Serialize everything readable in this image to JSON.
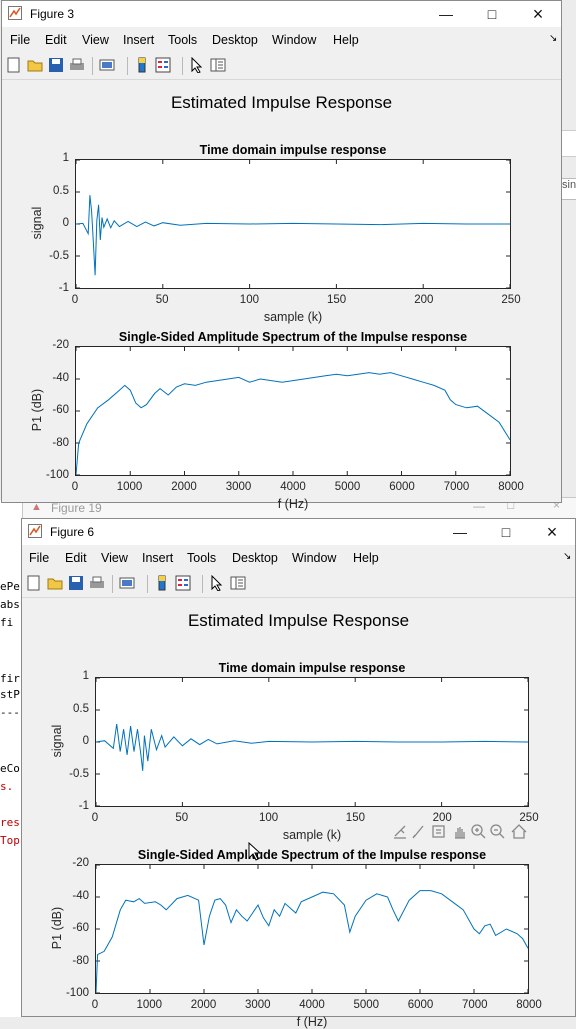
{
  "background": {
    "left_code_lines": [
      {
        "text": "ePe",
        "color": "#000000"
      },
      {
        "text": "abs",
        "color": "#000000"
      },
      {
        "text": " fi",
        "color": "#000000"
      },
      {
        "text": "fir",
        "color": "#000000"
      },
      {
        "text": "stP",
        "color": "#000000"
      },
      {
        "text": "---",
        "color": "#000000"
      },
      {
        "text": "eCo",
        "color": "#000000"
      },
      {
        "text": "s.",
        "color": "#c00000"
      },
      {
        "text": "res",
        "color": "#c00000"
      },
      {
        "text": "Top",
        "color": "#c00000"
      }
    ],
    "right_snippet": "sin",
    "figure19_title": "Figure 19"
  },
  "windows": [
    {
      "title": "Figure 3",
      "menus": [
        "File",
        "Edit",
        "View",
        "Insert",
        "Tools",
        "Desktop",
        "Window",
        "Help"
      ],
      "figure_title": "Estimated Impulse Response",
      "axes": [
        {
          "title": "Time domain impulse response",
          "xlabel": "sample (k)",
          "ylabel": "signal",
          "xticks": [
            "0",
            "50",
            "100",
            "150",
            "200",
            "250"
          ],
          "yticks": [
            "1",
            "0.5",
            "0",
            "-0.5",
            "-1"
          ]
        },
        {
          "title": "Single-Sided Amplitude Spectrum of the Impulse response",
          "xlabel": "f (Hz)",
          "ylabel": "P1 (dB)",
          "xticks": [
            "0",
            "1000",
            "2000",
            "3000",
            "4000",
            "5000",
            "6000",
            "7000",
            "8000"
          ],
          "yticks": [
            "-20",
            "-40",
            "-60",
            "-80",
            "-100"
          ]
        }
      ]
    },
    {
      "title": "Figure 6",
      "menus": [
        "File",
        "Edit",
        "View",
        "Insert",
        "Tools",
        "Desktop",
        "Window",
        "Help"
      ],
      "figure_title": "Estimated Impulse Response",
      "axes": [
        {
          "title": "Time domain impulse response",
          "xlabel": "sample (k)",
          "ylabel": "signal",
          "xticks": [
            "0",
            "50",
            "100",
            "150",
            "200",
            "250"
          ],
          "yticks": [
            "1",
            "0.5",
            "0",
            "-0.5",
            "-1"
          ]
        },
        {
          "title": "Single-Sided Amplitude Spectrum of the Impulse response",
          "xlabel": "f (Hz)",
          "ylabel": "P1 (dB)",
          "xticks": [
            "0",
            "1000",
            "2000",
            "3000",
            "4000",
            "5000",
            "6000",
            "7000",
            "8000"
          ],
          "yticks": [
            "-20",
            "-40",
            "-60",
            "-80",
            "-100"
          ]
        }
      ]
    }
  ],
  "chart_data": [
    {
      "type": "line",
      "figure": "Figure 3",
      "title": "Time domain impulse response",
      "xlabel": "sample (k)",
      "ylabel": "signal",
      "xlim": [
        0,
        250
      ],
      "ylim": [
        -1,
        1
      ],
      "grid": false,
      "color": "#0072bd",
      "series": [
        {
          "points": [
            [
              0,
              0
            ],
            [
              4,
              0.01
            ],
            [
              7,
              -0.15
            ],
            [
              8,
              0.45
            ],
            [
              9,
              0.2
            ],
            [
              10,
              -0.3
            ],
            [
              11,
              -0.8
            ],
            [
              12,
              0.05
            ],
            [
              13,
              0.3
            ],
            [
              14,
              -0.25
            ],
            [
              15,
              0.1
            ],
            [
              16,
              -0.05
            ],
            [
              18,
              0.08
            ],
            [
              20,
              -0.06
            ],
            [
              22,
              0.05
            ],
            [
              25,
              -0.04
            ],
            [
              30,
              0.04
            ],
            [
              35,
              -0.04
            ],
            [
              40,
              0.03
            ],
            [
              45,
              -0.03
            ],
            [
              50,
              0.02
            ],
            [
              60,
              -0.02
            ],
            [
              75,
              0.01
            ],
            [
              100,
              0
            ],
            [
              125,
              0.01
            ],
            [
              150,
              0
            ],
            [
              175,
              -0.01
            ],
            [
              200,
              0.01
            ],
            [
              225,
              0
            ],
            [
              250,
              0
            ]
          ]
        }
      ]
    },
    {
      "type": "line",
      "figure": "Figure 3",
      "title": "Single-Sided Amplitude Spectrum of the Impulse response",
      "xlabel": "f (Hz)",
      "ylabel": "P1 (dB)",
      "xlim": [
        0,
        8000
      ],
      "ylim": [
        -100,
        -20
      ],
      "grid": false,
      "color": "#0072bd",
      "series": [
        {
          "points": [
            [
              0,
              -100
            ],
            [
              50,
              -80
            ],
            [
              200,
              -68
            ],
            [
              400,
              -58
            ],
            [
              600,
              -53
            ],
            [
              800,
              -47
            ],
            [
              900,
              -44
            ],
            [
              1000,
              -47
            ],
            [
              1100,
              -55
            ],
            [
              1200,
              -58
            ],
            [
              1300,
              -56
            ],
            [
              1450,
              -49
            ],
            [
              1550,
              -46
            ],
            [
              1700,
              -50
            ],
            [
              1850,
              -45
            ],
            [
              2000,
              -43
            ],
            [
              2200,
              -44
            ],
            [
              2400,
              -42
            ],
            [
              2600,
              -41
            ],
            [
              2800,
              -40
            ],
            [
              3000,
              -39
            ],
            [
              3200,
              -42
            ],
            [
              3400,
              -40
            ],
            [
              3600,
              -41
            ],
            [
              3800,
              -42
            ],
            [
              4000,
              -41
            ],
            [
              4200,
              -40
            ],
            [
              4400,
              -39
            ],
            [
              4600,
              -38
            ],
            [
              4800,
              -37
            ],
            [
              5000,
              -38
            ],
            [
              5200,
              -37
            ],
            [
              5400,
              -36
            ],
            [
              5600,
              -37
            ],
            [
              5800,
              -36
            ],
            [
              6000,
              -38
            ],
            [
              6200,
              -40
            ],
            [
              6400,
              -42
            ],
            [
              6600,
              -44
            ],
            [
              6800,
              -47
            ],
            [
              6900,
              -53
            ],
            [
              7000,
              -56
            ],
            [
              7200,
              -58
            ],
            [
              7400,
              -57
            ],
            [
              7600,
              -62
            ],
            [
              7800,
              -67
            ],
            [
              8000,
              -78
            ]
          ]
        }
      ]
    },
    {
      "type": "line",
      "figure": "Figure 6",
      "title": "Time domain impulse response",
      "xlabel": "sample (k)",
      "ylabel": "signal",
      "xlim": [
        0,
        250
      ],
      "ylim": [
        -1,
        1
      ],
      "grid": false,
      "color": "#0072bd",
      "series": [
        {
          "points": [
            [
              0,
              0
            ],
            [
              5,
              0.02
            ],
            [
              10,
              -0.1
            ],
            [
              12,
              0.28
            ],
            [
              14,
              -0.15
            ],
            [
              16,
              0.2
            ],
            [
              18,
              -0.2
            ],
            [
              20,
              0.25
            ],
            [
              22,
              -0.15
            ],
            [
              24,
              0.2
            ],
            [
              26,
              -0.2
            ],
            [
              27,
              -0.45
            ],
            [
              28,
              0.1
            ],
            [
              30,
              -0.3
            ],
            [
              32,
              0.2
            ],
            [
              35,
              -0.12
            ],
            [
              38,
              0.1
            ],
            [
              40,
              -0.08
            ],
            [
              45,
              0.08
            ],
            [
              50,
              -0.06
            ],
            [
              55,
              0.05
            ],
            [
              60,
              -0.04
            ],
            [
              65,
              0.04
            ],
            [
              70,
              -0.03
            ],
            [
              80,
              0.02
            ],
            [
              90,
              -0.02
            ],
            [
              100,
              0.01
            ],
            [
              125,
              0
            ],
            [
              150,
              0.01
            ],
            [
              175,
              0
            ],
            [
              200,
              0
            ],
            [
              225,
              0.01
            ],
            [
              250,
              0
            ]
          ]
        }
      ]
    },
    {
      "type": "line",
      "figure": "Figure 6",
      "title": "Single-Sided Amplitude Spectrum of the Impulse response",
      "xlabel": "f (Hz)",
      "ylabel": "P1 (dB)",
      "xlim": [
        0,
        8000
      ],
      "ylim": [
        -100,
        -20
      ],
      "grid": false,
      "color": "#0072bd",
      "series": [
        {
          "points": [
            [
              0,
              -100
            ],
            [
              30,
              -76
            ],
            [
              150,
              -74
            ],
            [
              300,
              -65
            ],
            [
              450,
              -48
            ],
            [
              550,
              -42
            ],
            [
              700,
              -43
            ],
            [
              800,
              -41
            ],
            [
              900,
              -44
            ],
            [
              1100,
              -43
            ],
            [
              1200,
              -45
            ],
            [
              1300,
              -48
            ],
            [
              1500,
              -41
            ],
            [
              1700,
              -39
            ],
            [
              1900,
              -42
            ],
            [
              2000,
              -70
            ],
            [
              2100,
              -52
            ],
            [
              2200,
              -42
            ],
            [
              2300,
              -41
            ],
            [
              2400,
              -45
            ],
            [
              2500,
              -56
            ],
            [
              2600,
              -48
            ],
            [
              2700,
              -52
            ],
            [
              2800,
              -55
            ],
            [
              2900,
              -50
            ],
            [
              3000,
              -45
            ],
            [
              3100,
              -53
            ],
            [
              3200,
              -58
            ],
            [
              3300,
              -48
            ],
            [
              3400,
              -52
            ],
            [
              3500,
              -44
            ],
            [
              3600,
              -47
            ],
            [
              3700,
              -50
            ],
            [
              3800,
              -43
            ],
            [
              4000,
              -40
            ],
            [
              4200,
              -37
            ],
            [
              4400,
              -38
            ],
            [
              4600,
              -45
            ],
            [
              4700,
              -62
            ],
            [
              4800,
              -52
            ],
            [
              5000,
              -42
            ],
            [
              5200,
              -38
            ],
            [
              5400,
              -40
            ],
            [
              5500,
              -48
            ],
            [
              5600,
              -55
            ],
            [
              5800,
              -42
            ],
            [
              6000,
              -36
            ],
            [
              6200,
              -36
            ],
            [
              6400,
              -38
            ],
            [
              6600,
              -43
            ],
            [
              6800,
              -48
            ],
            [
              7000,
              -60
            ],
            [
              7100,
              -63
            ],
            [
              7200,
              -58
            ],
            [
              7300,
              -57
            ],
            [
              7400,
              -64
            ],
            [
              7600,
              -60
            ],
            [
              7800,
              -63
            ],
            [
              7900,
              -66
            ],
            [
              8000,
              -72
            ]
          ]
        }
      ]
    }
  ],
  "icons": {
    "close": "×",
    "maximize": "□",
    "minimize": "—",
    "overflow": "↘"
  }
}
